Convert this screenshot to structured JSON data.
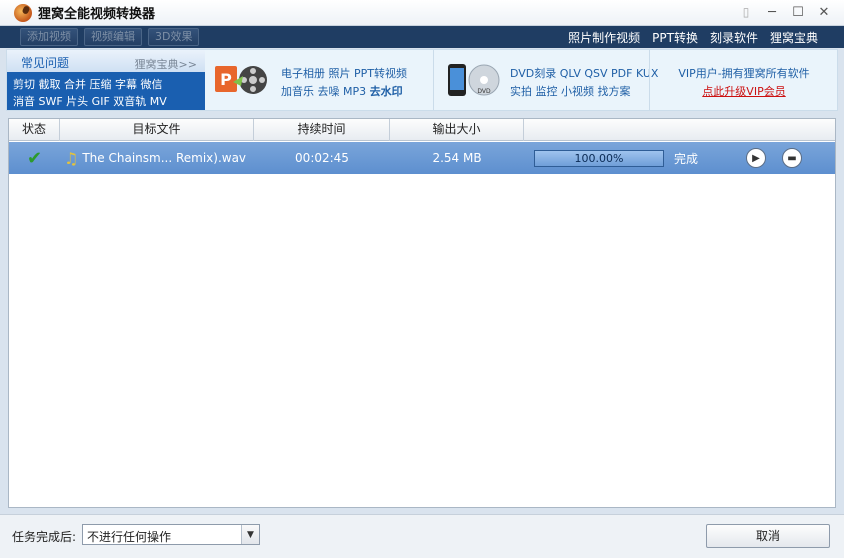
{
  "window": {
    "title": "狸窝全能视频转换器",
    "controls": [
      "pin-icon",
      "minimize-icon",
      "maximize-icon",
      "close-icon"
    ]
  },
  "toolbar": {
    "buttons": [
      "添加视频",
      "视频编辑",
      "3D效果"
    ],
    "links": [
      "照片制作视频",
      "PPT转换",
      "刻录软件",
      "狸窝宝典"
    ]
  },
  "faq": {
    "title": "常见问题",
    "more": "狸窝宝典>>",
    "line1": "剪切 截取 合并 压缩 字幕 微信",
    "line2": "消音 SWF 片头 GIF 双音轨 MV"
  },
  "promo1": {
    "line1": "电子相册 照片 PPT转视频",
    "line2a": "加音乐 去噪 MP3 ",
    "line2b": "去水印"
  },
  "promo2": {
    "line1": "DVD刻录 QLV QSV PDF KUX",
    "line2": "实拍 监控 小视频 找方案"
  },
  "promo3": {
    "line1": "VIP用户-拥有狸窝所有软件",
    "link": "点此升级VIP会员"
  },
  "table": {
    "headers": [
      "状态",
      "目标文件",
      "持续时间",
      "输出大小",
      ""
    ],
    "rows": [
      {
        "status_icon": "check-icon",
        "file": "The Chainsm... Remix).wav",
        "duration": "00:02:45",
        "size": "2.54 MB",
        "progress": 1.0,
        "progress_text": "100.00%",
        "state": "完成"
      }
    ]
  },
  "footer": {
    "label": "任务完成后:",
    "select_value": "不进行任何操作",
    "cancel": "取消"
  },
  "colors": {
    "toolbar_bg": "#1f3d63",
    "row_selected": "#6b9ad5",
    "faq_bg": "#1a5fb0",
    "vip_link": "#cc1010"
  }
}
